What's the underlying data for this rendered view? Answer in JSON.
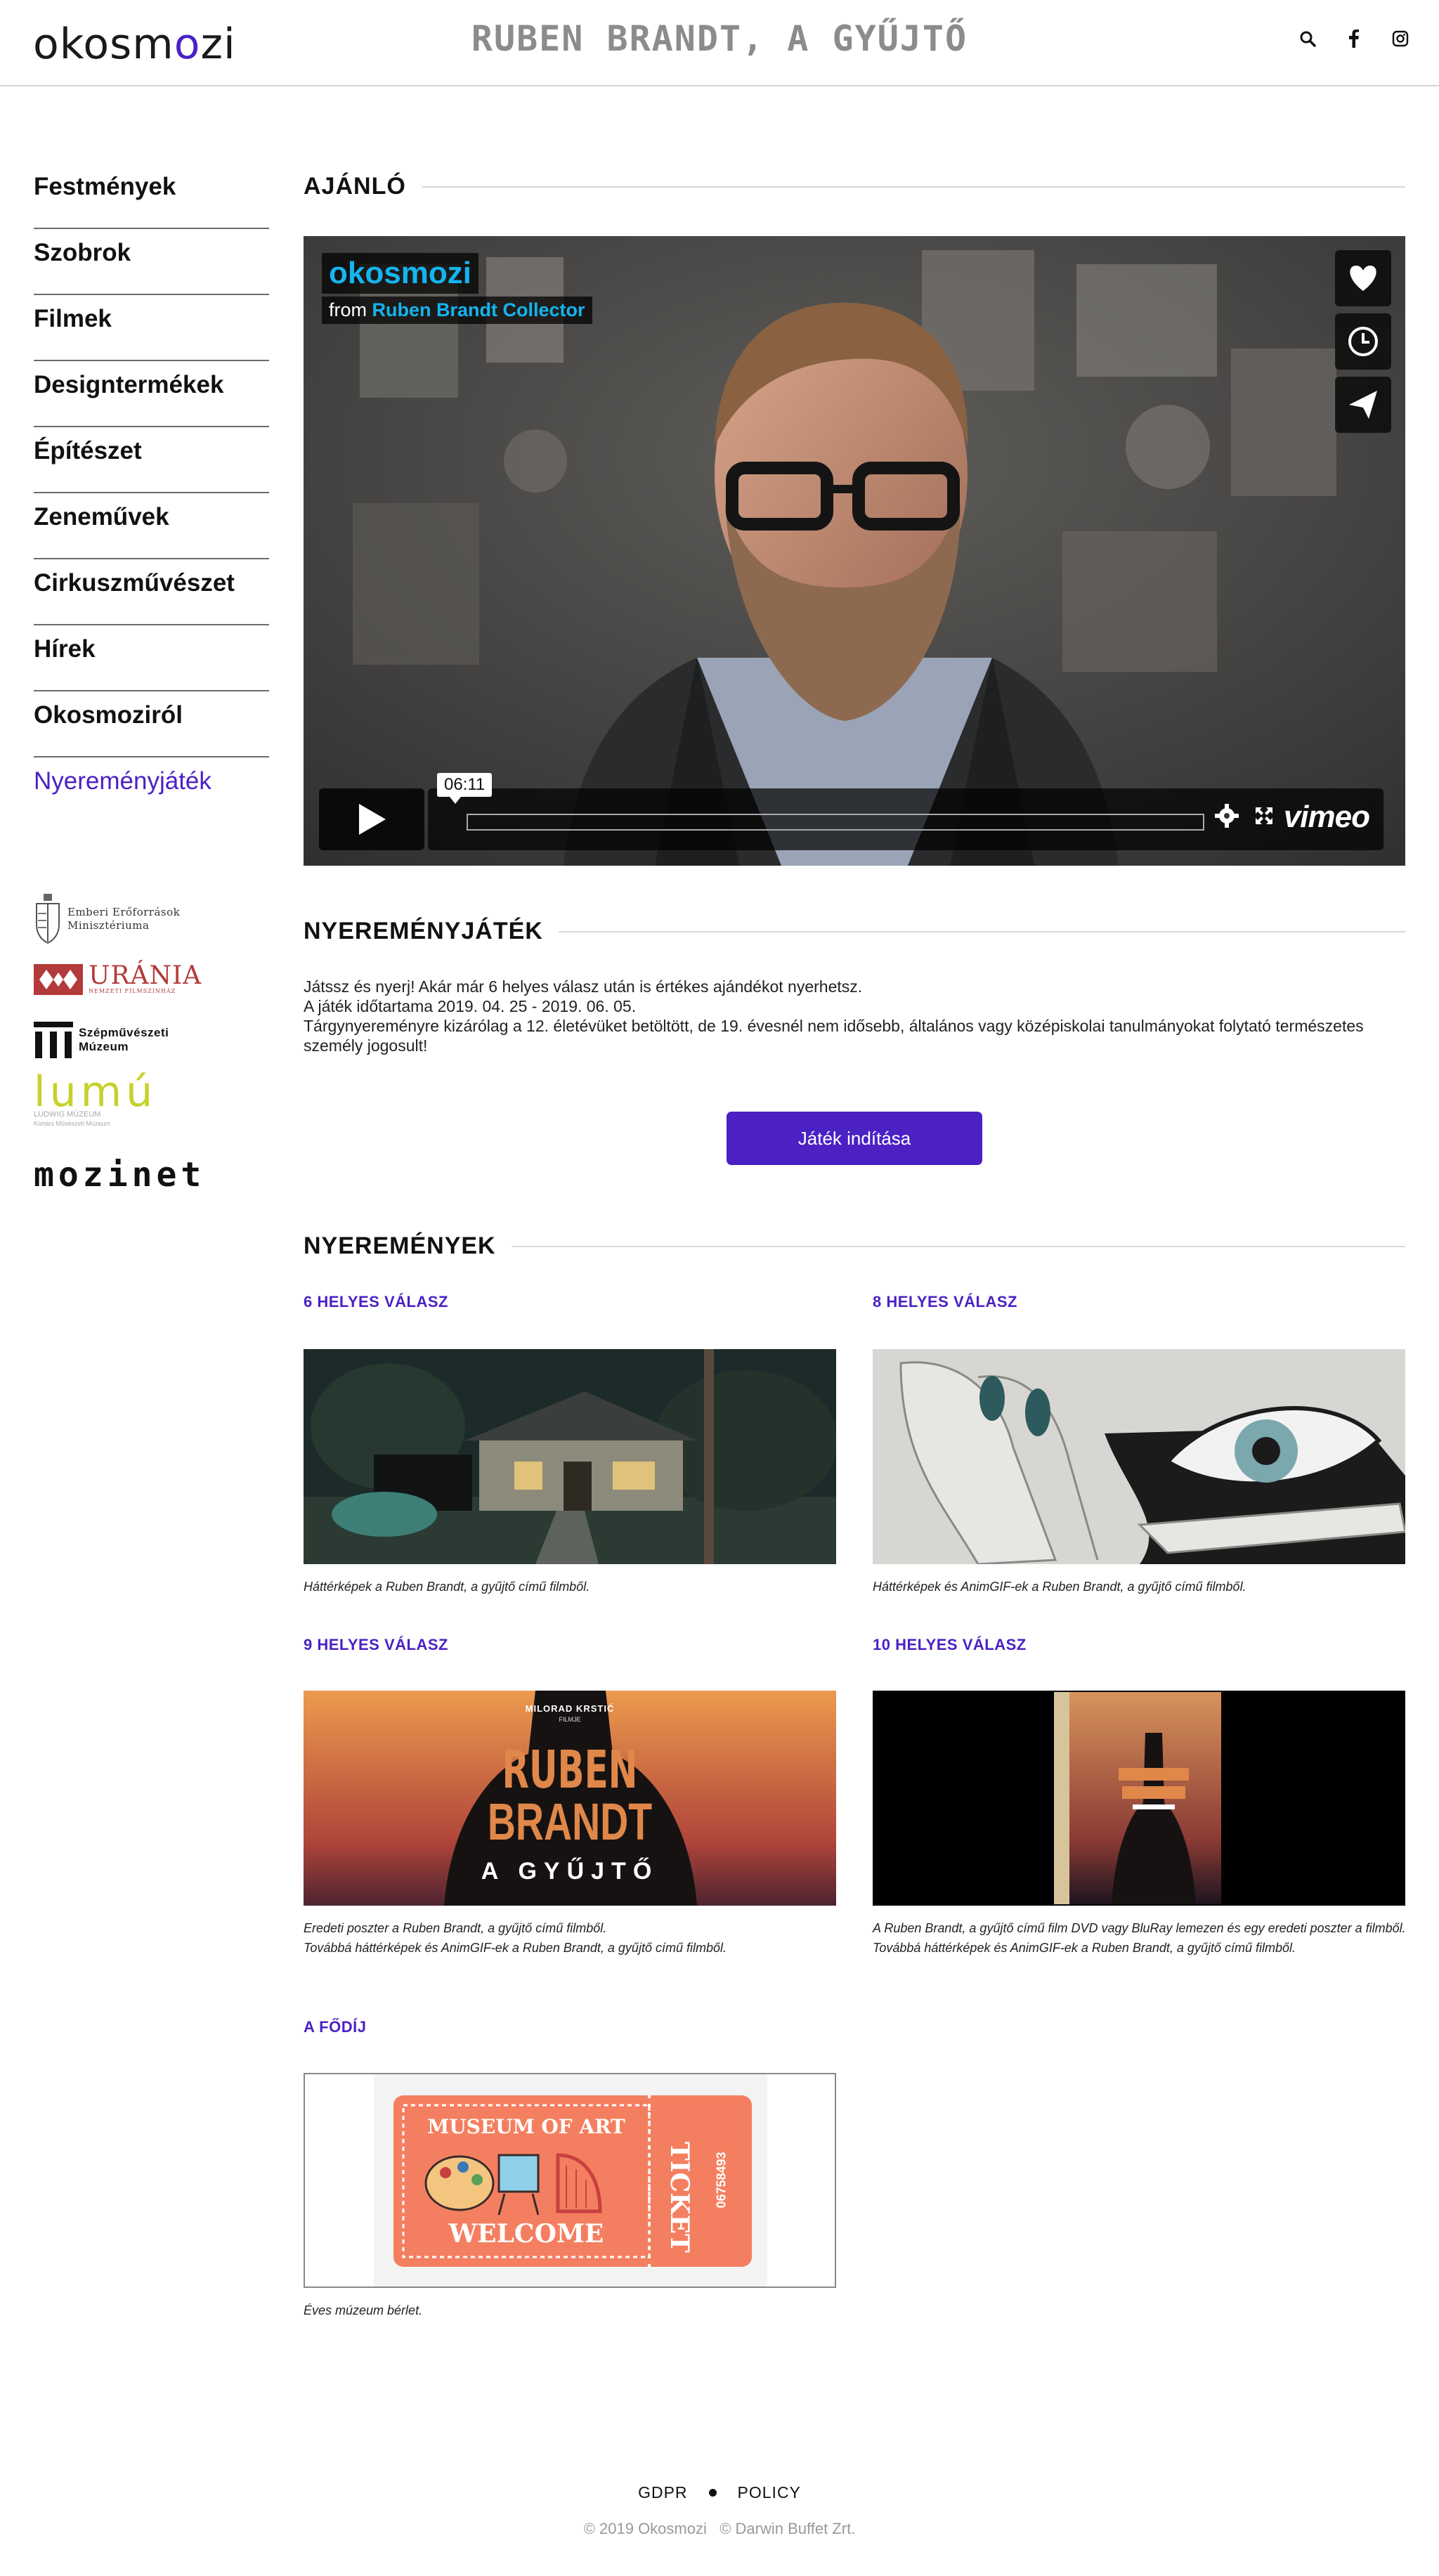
{
  "header": {
    "logo_text": "okosmozi",
    "title": "RUBEN BRANDT, A GYŰJTŐ",
    "icons": [
      "search-icon",
      "facebook-icon",
      "instagram-icon"
    ]
  },
  "sidebar": {
    "items": [
      {
        "label": "Festmények"
      },
      {
        "label": "Szobrok"
      },
      {
        "label": "Filmek"
      },
      {
        "label": "Designtermékek"
      },
      {
        "label": "Építészet"
      },
      {
        "label": "Zeneművek"
      },
      {
        "label": "Cirkuszművészet"
      },
      {
        "label": "Hírek"
      },
      {
        "label": "Okosmoziról"
      },
      {
        "label": "Nyereményjáték"
      }
    ],
    "partners": {
      "emmi_line1": "Emberi Erőforrások",
      "emmi_line2": "Minisztériuma",
      "urania": "URÁNIA",
      "urania_sub": "NEMZETI FILMSZÍNHÁZ",
      "szm_line1": "Szépművészeti",
      "szm_line2": "Múzeum",
      "lumu": "lumú",
      "lumu_sub1": "LUDWIG MÚZEUM",
      "lumu_sub2": "Kortárs Művészeti Múzeum",
      "mozinet": "mozinet"
    }
  },
  "recommend": {
    "title": "AJÁNLÓ",
    "video": {
      "channel": "okosmozi",
      "from_label": "from",
      "from_source": "Ruben Brandt Collector",
      "duration": "06:11",
      "brand": "vimeo",
      "side_icons": [
        "heart-icon",
        "clock-icon",
        "send-icon"
      ]
    }
  },
  "game": {
    "title": "NYEREMÉNYJÁTÉK",
    "lines": [
      "Játssz és nyerj! Akár már 6 helyes válasz után is értékes ajándékot nyerhetsz.",
      "A játék időtartama 2019. 04. 25 - 2019. 06. 05.",
      "Tárgynyereményre kizárólag a 12. életévüket betöltött, de 19. évesnél nem idősebb, általános vagy középiskolai tanulmányokat folytató természetes személy jogosult!"
    ],
    "button": "Játék indítása"
  },
  "prizes": {
    "title": "NYEREMÉNYEK",
    "items": [
      {
        "label": "6 HELYES VÁLASZ",
        "caption1": "Háttérképek a Ruben Brandt, a gyűjtő című filmből.",
        "caption2": ""
      },
      {
        "label": "8 HELYES VÁLASZ",
        "caption1": "Háttérképek és AnimGIF-ek a Ruben Brandt, a gyűjtő című filmből.",
        "caption2": ""
      },
      {
        "label": "9 HELYES VÁLASZ",
        "caption1": "Eredeti poszter a Ruben Brandt, a gyűjtő című filmből.",
        "caption2": "Továbbá háttérképek és AnimGIF-ek a Ruben Brandt, a gyűjtő című filmből."
      },
      {
        "label": "10 HELYES VÁLASZ",
        "caption1": "A Ruben Brandt, a gyűjtő című film DVD vagy BluRay lemezen és egy eredeti poszter a filmből.",
        "caption2": "Továbbá háttérképek és AnimGIF-ek a Ruben Brandt, a gyűjtő című filmből."
      },
      {
        "label": "A FŐDÍJ",
        "caption1": "Éves múzeum bérlet.",
        "caption2": ""
      }
    ],
    "poster": {
      "director": "MILORAD KRSTIĆ",
      "film_label": "FILMJE",
      "title1": "RUBEN",
      "title2": "BRANDT",
      "subtitle": "A GYŰJTŐ"
    },
    "ticket": {
      "top": "MUSEUM OF ART",
      "bottom": "WELCOME",
      "side": "TICKET",
      "number": "06758493"
    }
  },
  "footer": {
    "links": [
      "GDPR",
      "POLICY"
    ],
    "copyright1": "© 2019 Okosmozi",
    "copyright2": "© Darwin Buffet Zrt."
  }
}
